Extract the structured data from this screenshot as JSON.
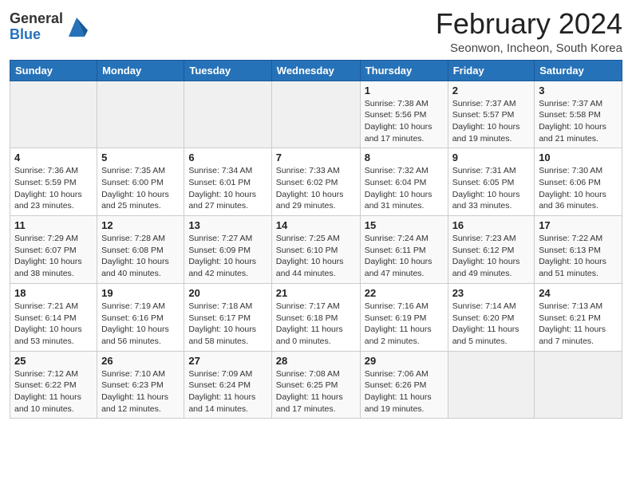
{
  "header": {
    "logo_general": "General",
    "logo_blue": "Blue",
    "month_title": "February 2024",
    "location": "Seonwon, Incheon, South Korea"
  },
  "days_of_week": [
    "Sunday",
    "Monday",
    "Tuesday",
    "Wednesday",
    "Thursday",
    "Friday",
    "Saturday"
  ],
  "weeks": [
    [
      {
        "day": "",
        "info": ""
      },
      {
        "day": "",
        "info": ""
      },
      {
        "day": "",
        "info": ""
      },
      {
        "day": "",
        "info": ""
      },
      {
        "day": "1",
        "info": "Sunrise: 7:38 AM\nSunset: 5:56 PM\nDaylight: 10 hours and 17 minutes."
      },
      {
        "day": "2",
        "info": "Sunrise: 7:37 AM\nSunset: 5:57 PM\nDaylight: 10 hours and 19 minutes."
      },
      {
        "day": "3",
        "info": "Sunrise: 7:37 AM\nSunset: 5:58 PM\nDaylight: 10 hours and 21 minutes."
      }
    ],
    [
      {
        "day": "4",
        "info": "Sunrise: 7:36 AM\nSunset: 5:59 PM\nDaylight: 10 hours and 23 minutes."
      },
      {
        "day": "5",
        "info": "Sunrise: 7:35 AM\nSunset: 6:00 PM\nDaylight: 10 hours and 25 minutes."
      },
      {
        "day": "6",
        "info": "Sunrise: 7:34 AM\nSunset: 6:01 PM\nDaylight: 10 hours and 27 minutes."
      },
      {
        "day": "7",
        "info": "Sunrise: 7:33 AM\nSunset: 6:02 PM\nDaylight: 10 hours and 29 minutes."
      },
      {
        "day": "8",
        "info": "Sunrise: 7:32 AM\nSunset: 6:04 PM\nDaylight: 10 hours and 31 minutes."
      },
      {
        "day": "9",
        "info": "Sunrise: 7:31 AM\nSunset: 6:05 PM\nDaylight: 10 hours and 33 minutes."
      },
      {
        "day": "10",
        "info": "Sunrise: 7:30 AM\nSunset: 6:06 PM\nDaylight: 10 hours and 36 minutes."
      }
    ],
    [
      {
        "day": "11",
        "info": "Sunrise: 7:29 AM\nSunset: 6:07 PM\nDaylight: 10 hours and 38 minutes."
      },
      {
        "day": "12",
        "info": "Sunrise: 7:28 AM\nSunset: 6:08 PM\nDaylight: 10 hours and 40 minutes."
      },
      {
        "day": "13",
        "info": "Sunrise: 7:27 AM\nSunset: 6:09 PM\nDaylight: 10 hours and 42 minutes."
      },
      {
        "day": "14",
        "info": "Sunrise: 7:25 AM\nSunset: 6:10 PM\nDaylight: 10 hours and 44 minutes."
      },
      {
        "day": "15",
        "info": "Sunrise: 7:24 AM\nSunset: 6:11 PM\nDaylight: 10 hours and 47 minutes."
      },
      {
        "day": "16",
        "info": "Sunrise: 7:23 AM\nSunset: 6:12 PM\nDaylight: 10 hours and 49 minutes."
      },
      {
        "day": "17",
        "info": "Sunrise: 7:22 AM\nSunset: 6:13 PM\nDaylight: 10 hours and 51 minutes."
      }
    ],
    [
      {
        "day": "18",
        "info": "Sunrise: 7:21 AM\nSunset: 6:14 PM\nDaylight: 10 hours and 53 minutes."
      },
      {
        "day": "19",
        "info": "Sunrise: 7:19 AM\nSunset: 6:16 PM\nDaylight: 10 hours and 56 minutes."
      },
      {
        "day": "20",
        "info": "Sunrise: 7:18 AM\nSunset: 6:17 PM\nDaylight: 10 hours and 58 minutes."
      },
      {
        "day": "21",
        "info": "Sunrise: 7:17 AM\nSunset: 6:18 PM\nDaylight: 11 hours and 0 minutes."
      },
      {
        "day": "22",
        "info": "Sunrise: 7:16 AM\nSunset: 6:19 PM\nDaylight: 11 hours and 2 minutes."
      },
      {
        "day": "23",
        "info": "Sunrise: 7:14 AM\nSunset: 6:20 PM\nDaylight: 11 hours and 5 minutes."
      },
      {
        "day": "24",
        "info": "Sunrise: 7:13 AM\nSunset: 6:21 PM\nDaylight: 11 hours and 7 minutes."
      }
    ],
    [
      {
        "day": "25",
        "info": "Sunrise: 7:12 AM\nSunset: 6:22 PM\nDaylight: 11 hours and 10 minutes."
      },
      {
        "day": "26",
        "info": "Sunrise: 7:10 AM\nSunset: 6:23 PM\nDaylight: 11 hours and 12 minutes."
      },
      {
        "day": "27",
        "info": "Sunrise: 7:09 AM\nSunset: 6:24 PM\nDaylight: 11 hours and 14 minutes."
      },
      {
        "day": "28",
        "info": "Sunrise: 7:08 AM\nSunset: 6:25 PM\nDaylight: 11 hours and 17 minutes."
      },
      {
        "day": "29",
        "info": "Sunrise: 7:06 AM\nSunset: 6:26 PM\nDaylight: 11 hours and 19 minutes."
      },
      {
        "day": "",
        "info": ""
      },
      {
        "day": "",
        "info": ""
      }
    ]
  ]
}
